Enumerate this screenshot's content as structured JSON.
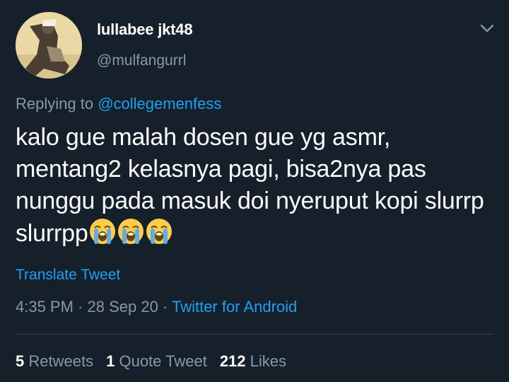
{
  "user": {
    "display_name": "lullabee jkt48",
    "handle": "@mulfangurrl"
  },
  "reply": {
    "prefix": "Replying to ",
    "mention": "@collegemenfess"
  },
  "tweet": {
    "text": "kalo gue malah dosen gue yg asmr, mentang2 kelasnya pagi, bisa2nya pas nunggu pada masuk doi nyeruput kopi slurrp slurrpp",
    "emojis": [
      "loudly-crying-face",
      "loudly-crying-face",
      "loudly-crying-face"
    ]
  },
  "translate_label": "Translate Tweet",
  "meta": {
    "time": "4:35 PM",
    "sep1": " · ",
    "date": "28 Sep 20",
    "sep2": " · ",
    "source": "Twitter for Android"
  },
  "stats": {
    "retweets_count": "5",
    "retweets_label": "Retweets",
    "quote_count": "1",
    "quote_label": "Quote Tweet",
    "likes_count": "212",
    "likes_label": "Likes"
  },
  "colors": {
    "background": "#15202b",
    "text": "#ffffff",
    "secondary": "#8899a6",
    "accent": "#1da1f2",
    "divider": "#38444d"
  }
}
